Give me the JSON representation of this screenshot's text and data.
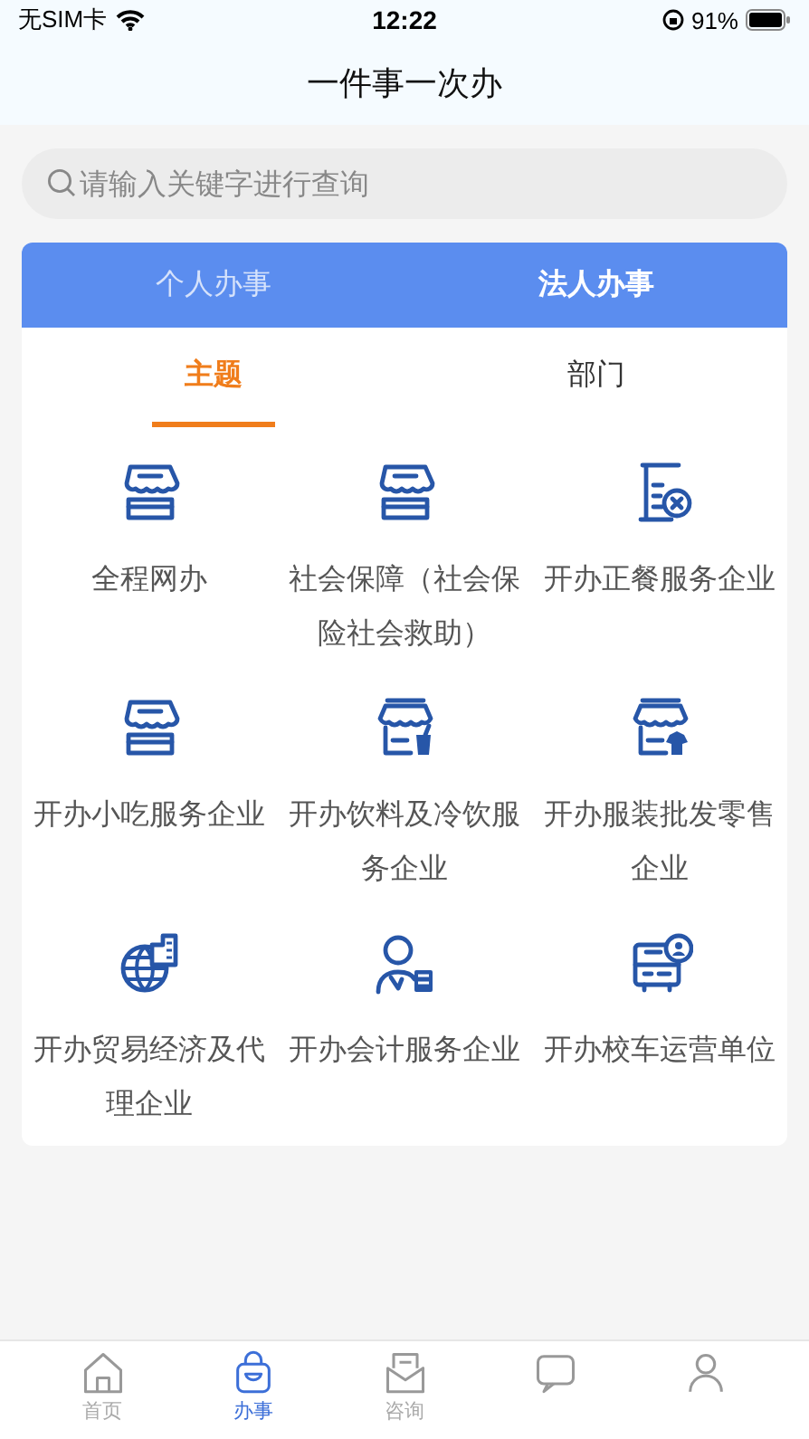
{
  "status_bar": {
    "carrier": "无SIM卡",
    "time": "12:22",
    "battery": "91%"
  },
  "title": "一件事一次办",
  "search": {
    "placeholder": "请输入关键字进行查询"
  },
  "tabs": [
    {
      "label": "个人办事",
      "selected": false
    },
    {
      "label": "法人办事",
      "selected": true
    }
  ],
  "subtabs": [
    {
      "label": "主题",
      "selected": true
    },
    {
      "label": "部门",
      "selected": false
    }
  ],
  "services": [
    {
      "label": "全程网办"
    },
    {
      "label": "社会保障（社会保险社会救助）"
    },
    {
      "label": "开办正餐服务企业"
    },
    {
      "label": "开办小吃服务企业"
    },
    {
      "label": "开办饮料及冷饮服务企业"
    },
    {
      "label": "开办服装批发零售企业"
    },
    {
      "label": "开办贸易经济及代理企业"
    },
    {
      "label": "开办会计服务企业"
    },
    {
      "label": "开办校车运营单位"
    }
  ],
  "bottom_nav": [
    {
      "label": "首页",
      "selected": false
    },
    {
      "label": "办事",
      "selected": true
    },
    {
      "label": "咨询",
      "selected": false
    },
    {
      "selected": false
    },
    {
      "selected": false
    }
  ]
}
